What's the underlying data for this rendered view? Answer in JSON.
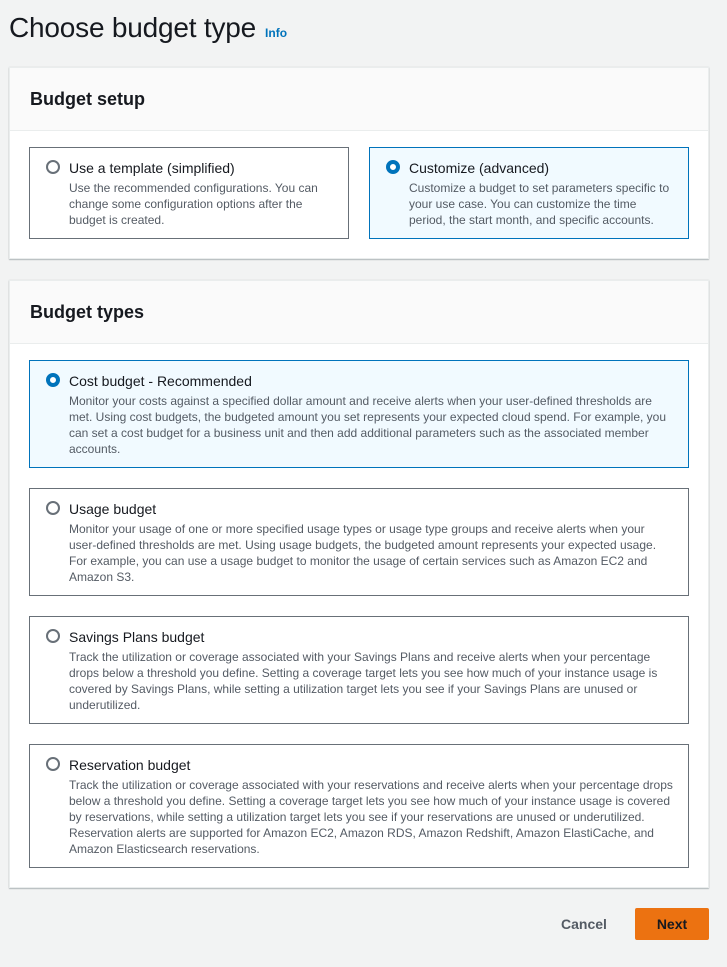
{
  "header": {
    "title": "Choose budget type",
    "info_link": "Info"
  },
  "budget_setup": {
    "title": "Budget setup",
    "options": [
      {
        "label": "Use a template (simplified)",
        "description": "Use the recommended configurations. You can change some configuration options after the budget is created.",
        "selected": false
      },
      {
        "label": "Customize (advanced)",
        "description": "Customize a budget to set parameters specific to your use case. You can customize the time period, the start month, and specific accounts.",
        "selected": true
      }
    ]
  },
  "budget_types": {
    "title": "Budget types",
    "options": [
      {
        "label": "Cost budget - Recommended",
        "description": "Monitor your costs against a specified dollar amount and receive alerts when your user-defined thresholds are met. Using cost budgets, the budgeted amount you set represents your expected cloud spend. For example, you can set a cost budget for a business unit and then add additional parameters such as the associated member accounts.",
        "selected": true
      },
      {
        "label": "Usage budget",
        "description": "Monitor your usage of one or more specified usage types or usage type groups and receive alerts when your user-defined thresholds are met. Using usage budgets, the budgeted amount represents your expected usage. For example, you can use a usage budget to monitor the usage of certain services such as Amazon EC2 and Amazon S3.",
        "selected": false
      },
      {
        "label": "Savings Plans budget",
        "description": "Track the utilization or coverage associated with your Savings Plans and receive alerts when your percentage drops below a threshold you define. Setting a coverage target lets you see how much of your instance usage is covered by Savings Plans, while setting a utilization target lets you see if your Savings Plans are unused or underutilized.",
        "selected": false
      },
      {
        "label": "Reservation budget",
        "description": "Track the utilization or coverage associated with your reservations and receive alerts when your percentage drops below a threshold you define. Setting a coverage target lets you see how much of your instance usage is covered by reservations, while setting a utilization target lets you see if your reservations are unused or underutilized. Reservation alerts are supported for Amazon EC2, Amazon RDS, Amazon Redshift, Amazon ElastiCache, and Amazon Elasticsearch reservations.",
        "selected": false
      }
    ]
  },
  "footer": {
    "cancel_label": "Cancel",
    "next_label": "Next"
  },
  "colors": {
    "accent": "#0073bb",
    "primary_button": "#ec7211",
    "selected_tile_bg": "#f1faff"
  }
}
